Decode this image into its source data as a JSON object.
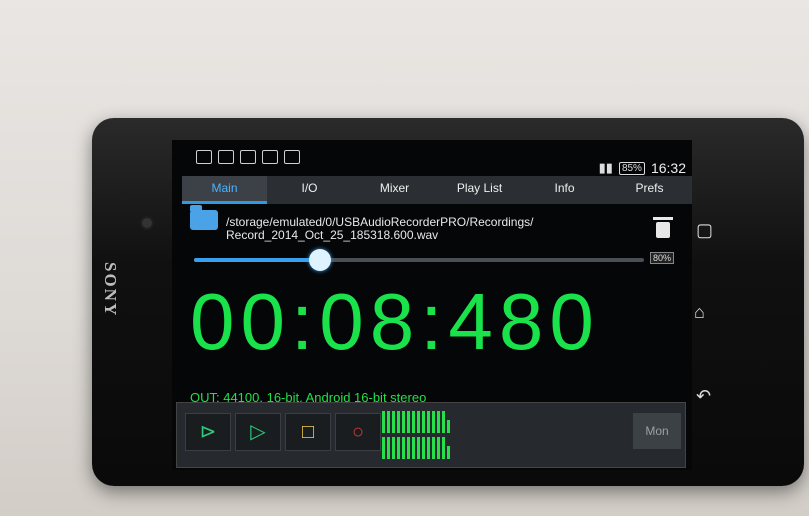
{
  "brand": "SONY",
  "status": {
    "battery": "85%",
    "clock": "16:32"
  },
  "tabs": [
    {
      "label": "Main",
      "active": true
    },
    {
      "label": "I/O",
      "active": false
    },
    {
      "label": "Mixer",
      "active": false
    },
    {
      "label": "Play List",
      "active": false
    },
    {
      "label": "Info",
      "active": false
    },
    {
      "label": "Prefs",
      "active": false
    }
  ],
  "file": {
    "path_line1": "/storage/emulated/0/USBAudioRecorderPRO/Recordings/",
    "path_line2": "Record_2014_Oct_25_185318.600.wav",
    "storage": "80%"
  },
  "playback": {
    "progress": 0.28,
    "timer": "00:08:480"
  },
  "output_info": "OUT: 44100, 16-bit, Android 16-bit stereo",
  "controls": {
    "mon_label": "Mon",
    "meter_levels": [
      1,
      1,
      1,
      1,
      1,
      1,
      1,
      1,
      1,
      1,
      1,
      1,
      1,
      0.6
    ]
  },
  "colors": {
    "accent": "#2e9be3",
    "timer_green": "#19e24a"
  },
  "icons": {
    "folder": "folder-icon",
    "trash": "trash-icon",
    "play_from_start": "play-from-start-icon",
    "play": "play-icon",
    "stop": "stop-icon",
    "record": "record-icon",
    "home": "home-icon",
    "back": "back-icon",
    "recent": "recent-apps-icon"
  }
}
